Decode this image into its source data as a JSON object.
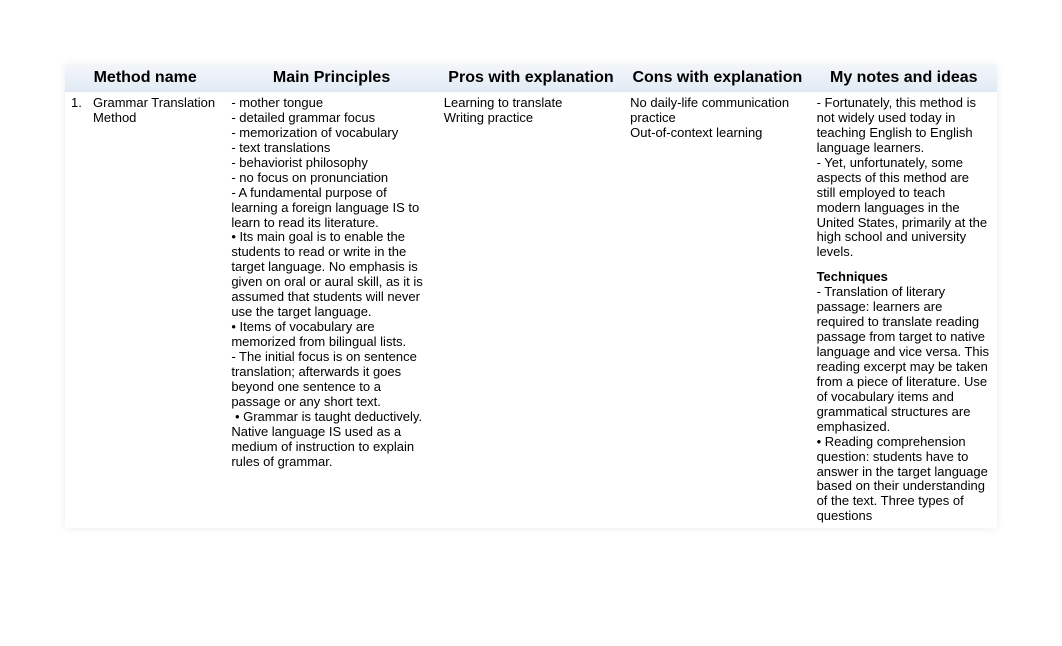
{
  "headers": {
    "method": "Method name",
    "principles": "Main Principles",
    "pros": "Pros with explanation",
    "cons": "Cons with explanation",
    "notes": "My notes and ideas"
  },
  "row": {
    "num": "1.",
    "name": "Grammar Translation Method",
    "principles": "- mother tongue\n- detailed grammar focus\n- memorization of vocabulary\n- text translations\n- behaviorist philosophy\n- no focus on pronunciation\n- A fundamental purpose of learning a foreign language IS to learn to read its literature.\n• Its main goal is to enable the students to read or write in the target language. No emphasis is given on oral or aural skill, as it is assumed that students will never\nuse the target language.\n• Items of vocabulary are memorized from bilingual lists.\n- The initial focus is on sentence translation; afterwards it goes beyond one sentence to a passage or any short text.\n • Grammar is taught deductively. Native language IS used as a medium of instruction to explain rules of grammar.",
    "pros": "Learning to translate\nWriting practice",
    "cons": "No daily-life communication practice\nOut-of-context learning",
    "notes_intro": "- Fortunately, this method is not widely used today in teaching English to English language learners.\n- Yet, unfortunately, some aspects of this method are still employed to teach modern languages in the United States, primarily at the high school and university levels.",
    "notes_heading": "Techniques",
    "notes_body": "- Translation of literary passage: learners are required to translate reading passage from target to native language and vice versa. This reading excerpt may be taken from a piece of literature. Use of vocabulary items and grammatical structures are emphasized.\n• Reading comprehension question: students have to answer in the target language based on their understanding of the text. Three types of questions"
  }
}
